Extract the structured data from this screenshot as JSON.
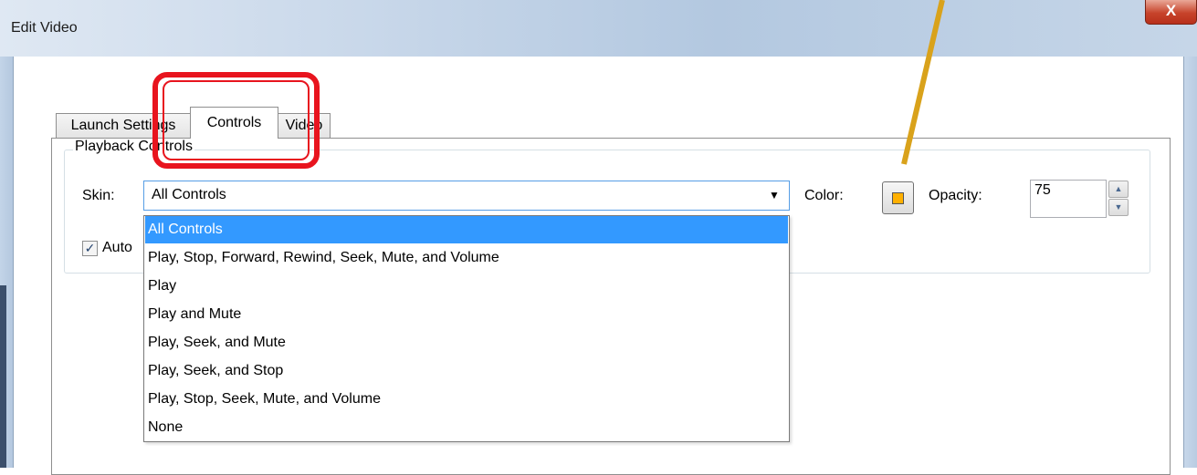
{
  "window": {
    "title": "Edit Video",
    "close_label": "X"
  },
  "tabs": [
    {
      "label": "Launch Settings",
      "active": false
    },
    {
      "label": "Controls",
      "active": true
    },
    {
      "label": "Video",
      "active": false
    }
  ],
  "playback": {
    "group_title": "Playback Controls",
    "skin_label": "Skin:",
    "skin_value": "All Controls",
    "color_label": "Color:",
    "color_value": "#ffb000",
    "opacity_label": "Opacity:",
    "opacity_value": "75",
    "autoplay_label": "Auto",
    "autoplay_checked": true
  },
  "skin_options": [
    "All Controls",
    "Play, Stop, Forward, Rewind, Seek, Mute, and Volume",
    "Play",
    "Play and Mute",
    "Play, Seek, and Mute",
    "Play, Seek, and Stop",
    "Play, Stop, Seek, Mute, and Volume",
    "None"
  ],
  "icons": {
    "close": "close-icon",
    "dropdown": "chevron-down-icon",
    "spin_up": "arrow-up-icon",
    "spin_down": "arrow-down-icon",
    "check": "checkmark-icon"
  },
  "colors": {
    "highlight": "#e8141e",
    "callout_arrow": "#d9a21b",
    "selection": "#3399ff"
  }
}
